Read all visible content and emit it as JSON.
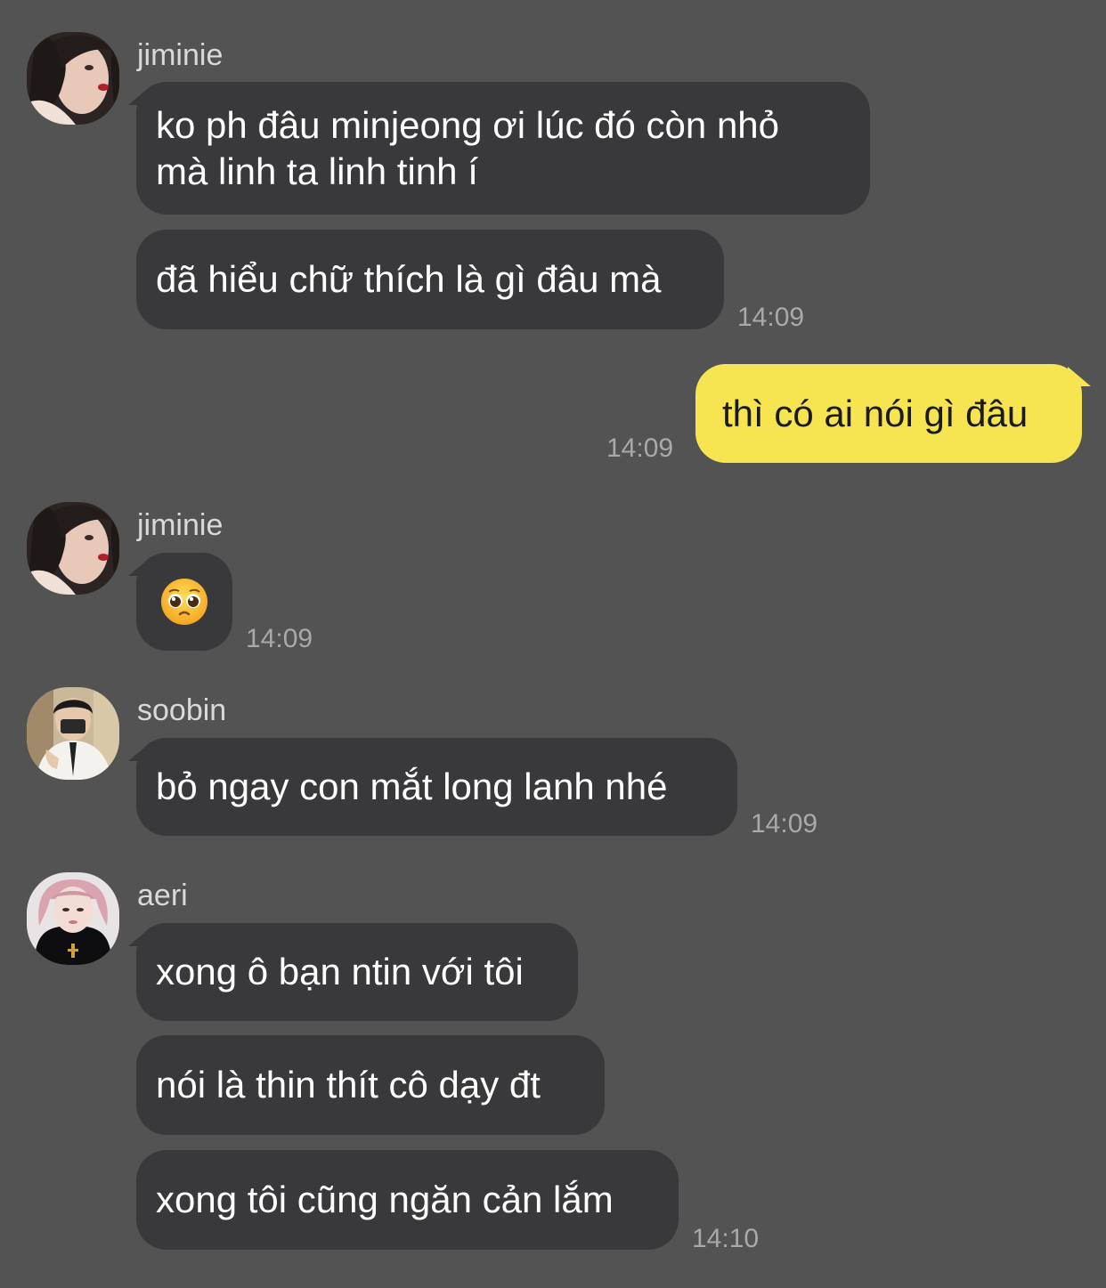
{
  "chat": {
    "groups": [
      {
        "sender": "jiminie",
        "messages": [
          "ko ph đâu minjeong ơi lúc đó còn nhỏ\nmà linh ta linh tinh í",
          "đã hiểu chữ thích là gì đâu mà"
        ],
        "time": "14:09"
      },
      {
        "sender": "me",
        "messages": [
          "thì có ai nói gì đâu"
        ],
        "time": "14:09"
      },
      {
        "sender": "jiminie",
        "messages": [
          "pleading-face-emoji"
        ],
        "time": "14:09"
      },
      {
        "sender": "soobin",
        "messages": [
          "bỏ ngay con mắt long lanh nhé"
        ],
        "time": "14:09"
      },
      {
        "sender": "aeri",
        "messages": [
          "xong ô bạn ntin với tôi",
          "nói là thin thít cô dạy đt",
          "xong tôi cũng ngăn cản lắm"
        ],
        "time": "14:10"
      }
    ]
  },
  "colors": {
    "background": "#535354",
    "incoming_bubble": "#39393b",
    "outgoing_bubble": "#f7e451"
  }
}
